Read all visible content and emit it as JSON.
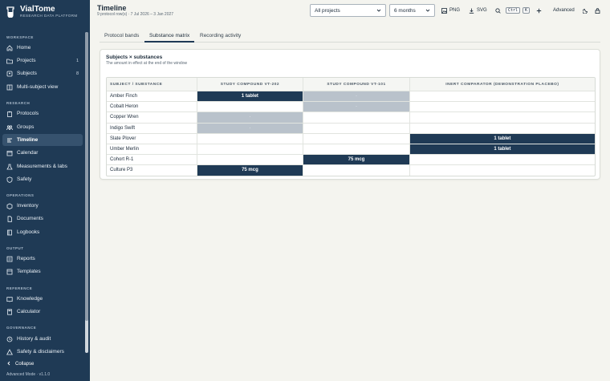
{
  "brand": {
    "name": "VialTome",
    "subtitle": "RESEARCH DATA PLATFORM"
  },
  "sidebar": {
    "sections": {
      "workspace": "WORKSPACE",
      "research": "RESEARCH",
      "operations": "OPERATIONS",
      "output": "OUTPUT",
      "reference": "REFERENCE",
      "governance": "GOVERNANCE"
    },
    "items": {
      "home": {
        "label": "Home"
      },
      "projects": {
        "label": "Projects",
        "count": "1"
      },
      "subjects": {
        "label": "Subjects",
        "count": "8"
      },
      "multi": {
        "label": "Multi-subject view"
      },
      "protocols": {
        "label": "Protocols"
      },
      "groups": {
        "label": "Groups"
      },
      "timeline": {
        "label": "Timeline"
      },
      "calendar": {
        "label": "Calendar"
      },
      "measurements": {
        "label": "Measurements & labs"
      },
      "safety": {
        "label": "Safety"
      },
      "inventory": {
        "label": "Inventory"
      },
      "documents": {
        "label": "Documents"
      },
      "logbooks": {
        "label": "Logbooks"
      },
      "reports": {
        "label": "Reports"
      },
      "templates": {
        "label": "Templates"
      },
      "knowledge": {
        "label": "Knowledge"
      },
      "calculator": {
        "label": "Calculator"
      },
      "history": {
        "label": "History & audit"
      },
      "disclaimers": {
        "label": "Safety & disclaimers"
      }
    },
    "collapse_label": "Collapse",
    "mode_label": "Advanced Mode · v1.1.0"
  },
  "header": {
    "title": "Timeline",
    "subtitle": "9 protocol row(s) · 7 Jul 2026 – 3 Jan 2027",
    "project_select": "All projects",
    "range_select": "6 months",
    "png_label": "PNG",
    "svg_label": "SVG",
    "kbd_ctrl": "Ctrl",
    "kbd_k": "K",
    "advanced_label": "Advanced"
  },
  "tabs": {
    "bands": "Protocol bands",
    "matrix": "Substance matrix",
    "recording": "Recording activity"
  },
  "matrix": {
    "title": "Subjects × substances",
    "subtitle": "The amount in effect at the end of the window",
    "headers": [
      "SUBJECT / SUBSTANCE",
      "STUDY COMPOUND VT-202",
      "STUDY COMPOUND VT-101",
      "INERT COMPARATOR (DEMONSTRATION PLACEBO)"
    ],
    "rows": [
      {
        "name": "Amber Finch",
        "cells": [
          {
            "t": "1 tablet",
            "f": "dark"
          },
          {
            "t": "·",
            "f": "gray"
          },
          {
            "t": "",
            "f": ""
          }
        ]
      },
      {
        "name": "Cobalt Heron",
        "cells": [
          {
            "t": "",
            "f": ""
          },
          {
            "t": "·",
            "f": "gray"
          },
          {
            "t": "",
            "f": ""
          }
        ]
      },
      {
        "name": "Copper Wren",
        "cells": [
          {
            "t": "·",
            "f": "gray"
          },
          {
            "t": "",
            "f": ""
          },
          {
            "t": "",
            "f": ""
          }
        ]
      },
      {
        "name": "Indigo Swift",
        "cells": [
          {
            "t": "·",
            "f": "gray"
          },
          {
            "t": "",
            "f": ""
          },
          {
            "t": "",
            "f": ""
          }
        ]
      },
      {
        "name": "Slate Plover",
        "cells": [
          {
            "t": "",
            "f": ""
          },
          {
            "t": "",
            "f": ""
          },
          {
            "t": "1 tablet",
            "f": "dark"
          }
        ]
      },
      {
        "name": "Umber Merlin",
        "cells": [
          {
            "t": "",
            "f": ""
          },
          {
            "t": "",
            "f": ""
          },
          {
            "t": "1 tablet",
            "f": "dark"
          }
        ]
      },
      {
        "name": "Cohort R-1",
        "cells": [
          {
            "t": "",
            "f": ""
          },
          {
            "t": "75 mcg",
            "f": "dark"
          },
          {
            "t": "",
            "f": ""
          }
        ]
      },
      {
        "name": "Culture P3",
        "cells": [
          {
            "t": "75 mcg",
            "f": "dark"
          },
          {
            "t": "",
            "f": ""
          },
          {
            "t": "",
            "f": ""
          }
        ]
      }
    ]
  },
  "colors": {
    "sidebar": "#1f3a55",
    "accent": "#1f3a55",
    "muted_fill": "#b9c2cb"
  }
}
